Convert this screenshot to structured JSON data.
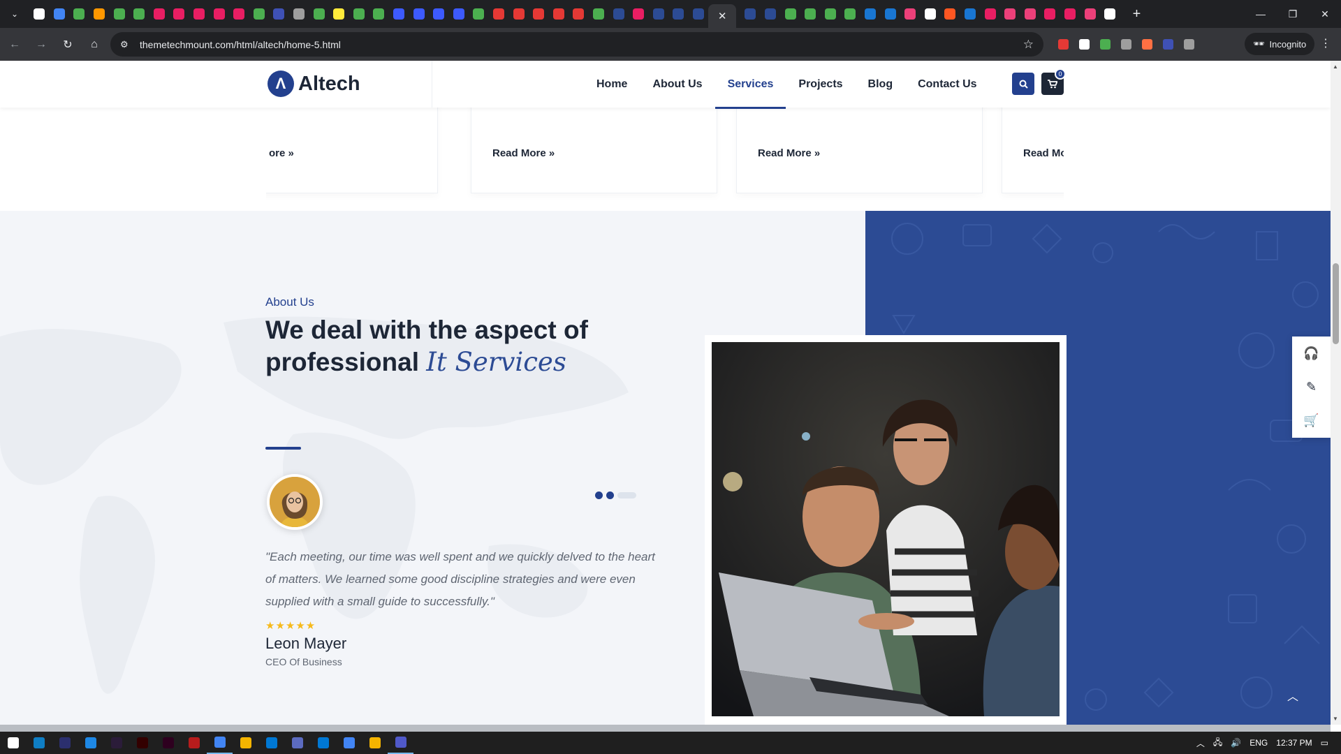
{
  "browser": {
    "tab_icon_colors": [
      "#ffffff",
      "#4285f4",
      "#4caf50",
      "#ff9800",
      "#4caf50",
      "#4caf50",
      "#e91e63",
      "#e91e63",
      "#e91e63",
      "#e91e63",
      "#e91e63",
      "#4caf50",
      "#3f51b5",
      "#9e9e9e",
      "#4caf50",
      "#ffeb3b",
      "#4caf50",
      "#4caf50",
      "#3d5afe",
      "#3d5afe",
      "#3d5afe",
      "#3d5afe",
      "#4caf50",
      "#e53935",
      "#e53935",
      "#e53935",
      "#e53935",
      "#e53935",
      "#4caf50",
      "#2c4b94",
      "#e91e63",
      "#2c4b94",
      "#2c4b94",
      "#2c4b94"
    ],
    "tab_icon_colors_after": [
      "#2c4b94",
      "#2c4b94",
      "#4caf50",
      "#4caf50",
      "#4caf50",
      "#4caf50",
      "#1976d2",
      "#1976d2",
      "#ec407a",
      "#ffffff",
      "#ff5722",
      "#1976d2",
      "#e91e63",
      "#ec407a",
      "#ec407a",
      "#e91e63",
      "#e91e63",
      "#ec407a",
      "#ffffff"
    ],
    "url": "themetechmount.com/html/altech/home-5.html",
    "incognito_label": "Incognito",
    "extension_colors": [
      "#e53935",
      "#ffffff",
      "#4caf50",
      "#9e9e9e",
      "#ff7043",
      "#3f51b5",
      "#9e9e9e"
    ]
  },
  "site": {
    "brand": "Altech",
    "logo_letter": "Λ",
    "nav": [
      "Home",
      "About Us",
      "Services",
      "Projects",
      "Blog",
      "Contact Us"
    ],
    "active_nav": "Services",
    "cart_count": "0",
    "accent_color": "#23408e"
  },
  "cards": {
    "read_more": [
      "ore",
      "Read More",
      "Read More",
      "Read Mo"
    ]
  },
  "about": {
    "eyebrow": "About Us",
    "headline_main": "We deal with the aspect of professional",
    "headline_em": "It Services",
    "quote": "\"Each meeting, our time was well spent and we quickly delved to the heart of matters. We learned some good discipline strategies and were even supplied with a small guide to successfully.\"",
    "rating": 5,
    "stars": "★★★★★",
    "author": "Leon Mayer",
    "role": "CEO Of Business",
    "panel_color": "#2c4b94"
  },
  "taskbar": {
    "icon_colors": [
      "#ffffff",
      "#0f7ec4",
      "#2b2f6e",
      "#1e88e5",
      "#2b1c39",
      "#330000",
      "#2e001f",
      "#b71c1c",
      "#4285f4",
      "#f4b400",
      "#0078d4",
      "#5c6bc0",
      "#0078d4",
      "#4285f4",
      "#f4b400",
      "#5059c9"
    ],
    "lang": "ENG",
    "time": "12:37 PM"
  }
}
